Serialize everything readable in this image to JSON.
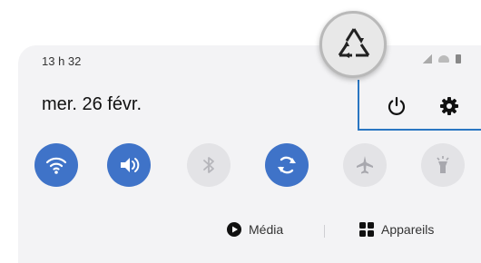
{
  "status_bar": {
    "time": "13 h 32"
  },
  "header": {
    "date": "mer. 26 févr."
  },
  "quick_actions": {
    "power": "power-icon",
    "settings": "gear-icon"
  },
  "badge": {
    "icon": "recycle-icon"
  },
  "tiles": [
    {
      "name": "wifi",
      "active": true
    },
    {
      "name": "sound",
      "active": true
    },
    {
      "name": "bluetooth",
      "active": false
    },
    {
      "name": "auto-rotate",
      "active": true
    },
    {
      "name": "airplane-mode",
      "active": false
    },
    {
      "name": "flashlight",
      "active": false
    }
  ],
  "bottom_bar": {
    "media_label": "Média",
    "devices_label": "Appareils"
  },
  "colors": {
    "accent": "#3f73c8",
    "highlight": "#2a76c2"
  }
}
